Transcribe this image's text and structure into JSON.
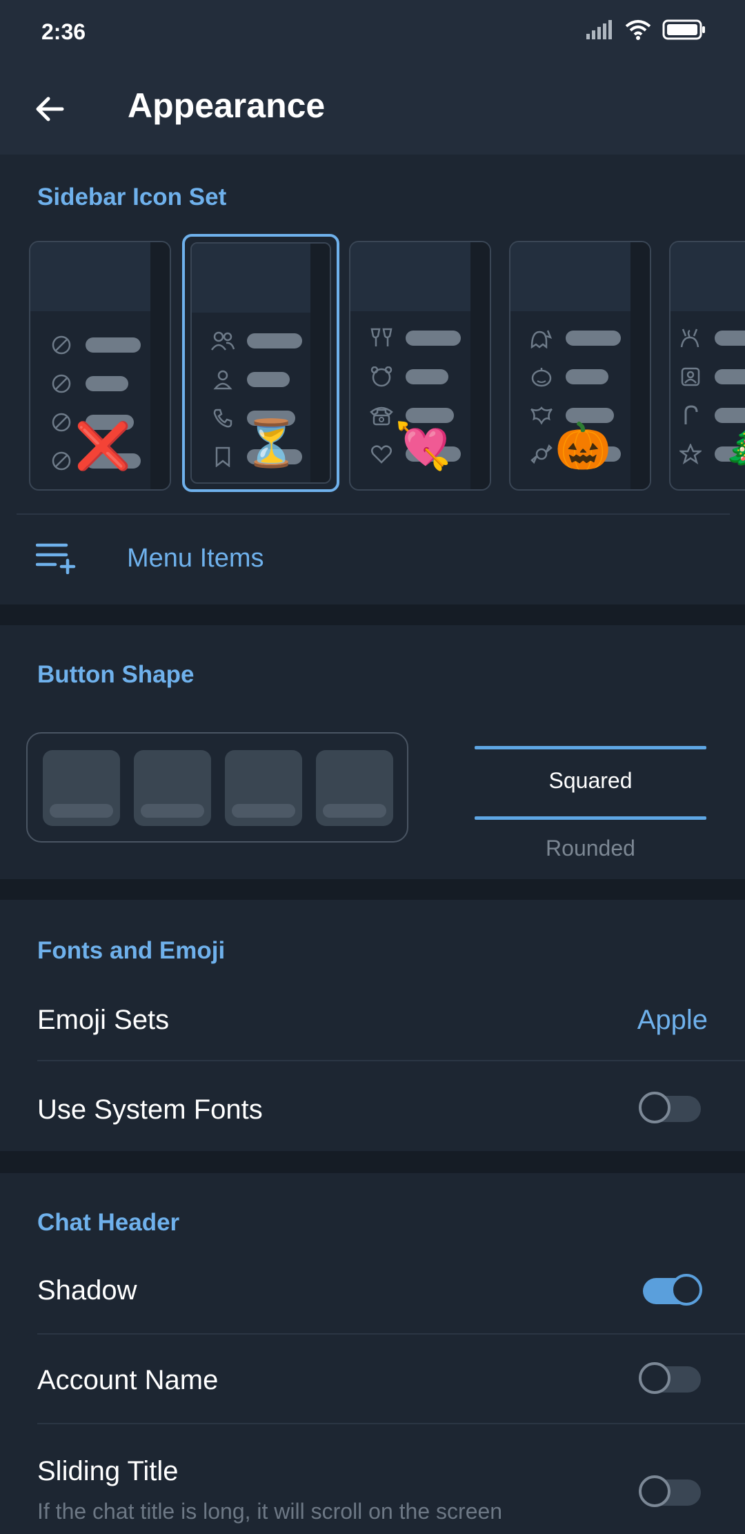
{
  "status": {
    "time": "2:36"
  },
  "header": {
    "title": "Appearance"
  },
  "sidebar_icon_set": {
    "title": "Sidebar Icon Set",
    "cards": [
      {
        "emoji": "❌",
        "selected": false
      },
      {
        "emoji": "⏳",
        "selected": true
      },
      {
        "emoji": "💘",
        "selected": false
      },
      {
        "emoji": "🎃",
        "selected": false
      },
      {
        "emoji": "🎄",
        "selected": false
      }
    ]
  },
  "menu_items": {
    "label": "Menu Items"
  },
  "button_shape": {
    "title": "Button Shape",
    "options": [
      "Squared",
      "Rounded"
    ],
    "selected": "Squared"
  },
  "fonts_emoji": {
    "title": "Fonts and Emoji",
    "emoji_sets": {
      "label": "Emoji Sets",
      "value": "Apple"
    },
    "system_fonts": {
      "label": "Use System Fonts",
      "enabled": false
    }
  },
  "chat_header": {
    "title": "Chat Header",
    "shadow": {
      "label": "Shadow",
      "enabled": true
    },
    "account_name": {
      "label": "Account Name",
      "enabled": false
    },
    "sliding_title": {
      "label": "Sliding Title",
      "description": "If the chat title is long, it will scroll on the screen",
      "enabled": false
    }
  },
  "colors": {
    "accent": "#6fb1ec",
    "background": "#1d2632",
    "header": "#232d3b"
  }
}
